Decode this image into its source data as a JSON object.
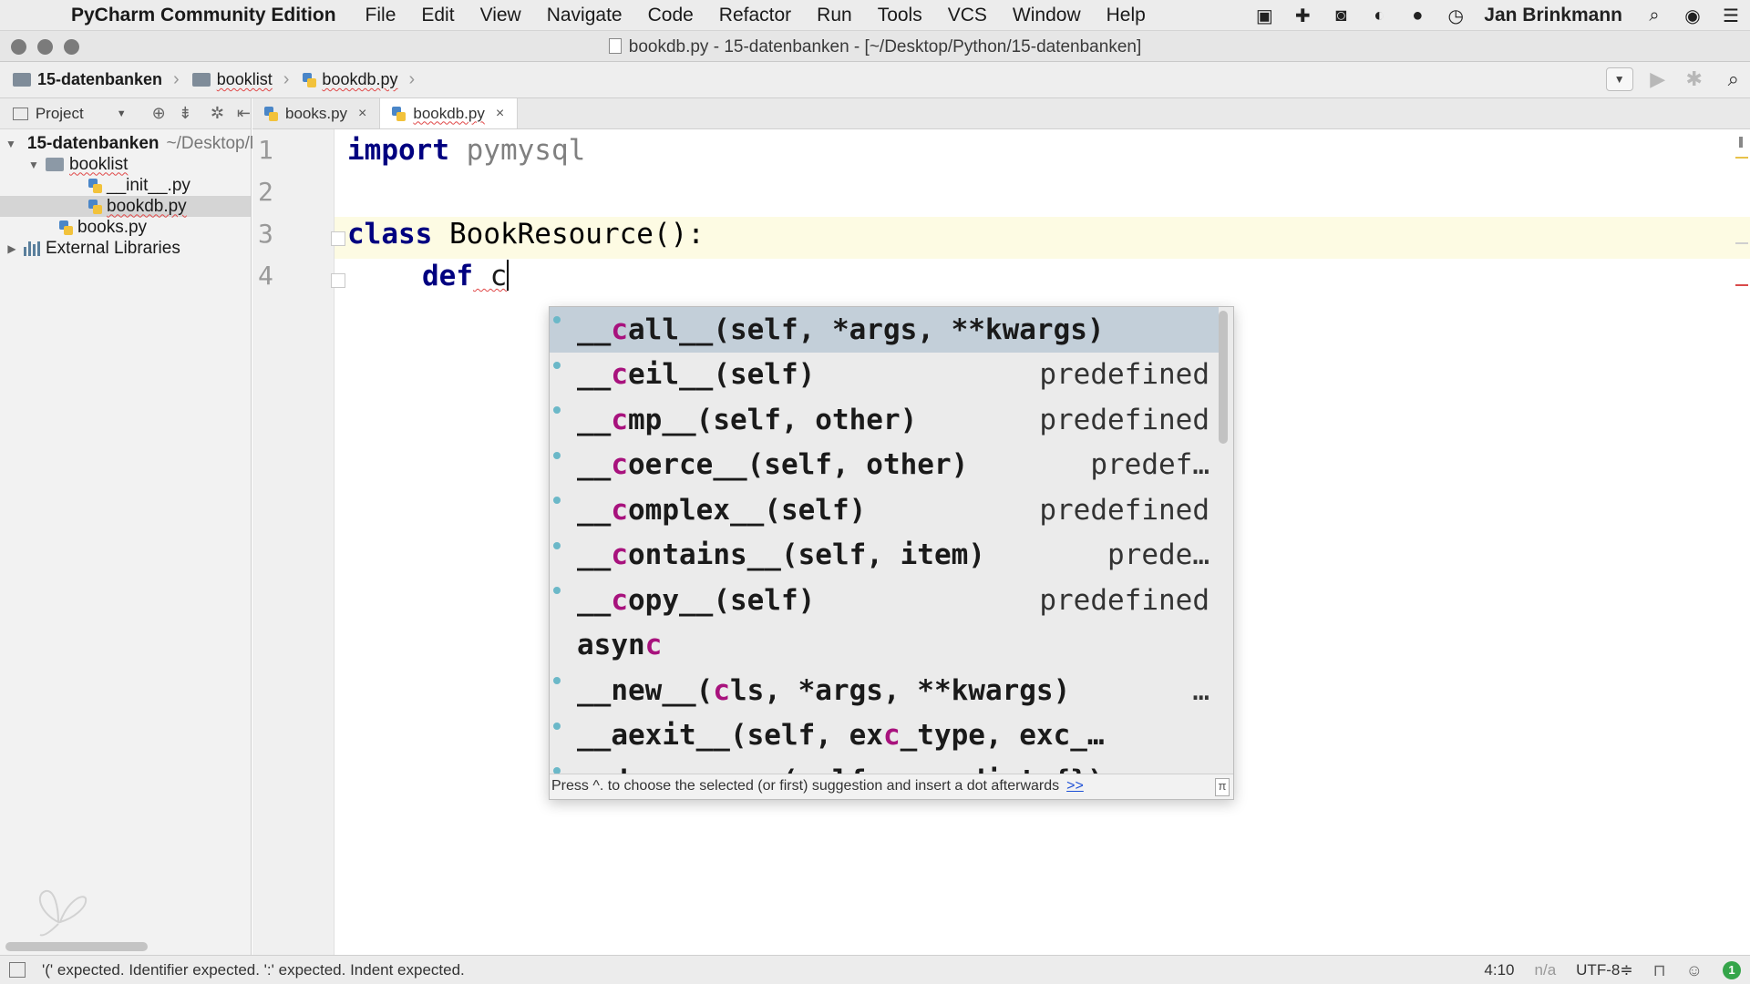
{
  "menubar": {
    "app_name": "PyCharm Community Edition",
    "items": [
      "File",
      "Edit",
      "View",
      "Navigate",
      "Code",
      "Refactor",
      "Run",
      "Tools",
      "VCS",
      "Window",
      "Help"
    ],
    "username": "Jan Brinkmann",
    "tray_icons": [
      "app-icon",
      "plus-cross-icon",
      "camera-icon",
      "leaf-icon",
      "chat-icon",
      "time-machine-icon"
    ]
  },
  "window": {
    "title": "bookdb.py - 15-datenbanken - [~/Desktop/Python/15-datenbanken]"
  },
  "breadcrumbs": [
    "15-datenbanken",
    "booklist",
    "bookdb.py"
  ],
  "project_panel": {
    "title": "Project",
    "tree": [
      {
        "label": "15-datenbanken",
        "path": "~/Desktop/l",
        "level": 0,
        "type": "folder",
        "expanded": true
      },
      {
        "label": "booklist",
        "level": 1,
        "type": "folder",
        "expanded": true
      },
      {
        "label": "__init__.py",
        "level": 2,
        "type": "python"
      },
      {
        "label": "bookdb.py",
        "level": 2,
        "type": "python",
        "selected": true
      },
      {
        "label": "books.py",
        "level": 1,
        "type": "python"
      },
      {
        "label": "External Libraries",
        "level": 0,
        "type": "library",
        "expanded": false
      }
    ]
  },
  "tabs": [
    {
      "label": "books.py",
      "active": false
    },
    {
      "label": "bookdb.py",
      "active": true
    }
  ],
  "editor": {
    "line_numbers": [
      "1",
      "2",
      "3",
      "4"
    ],
    "lines": [
      {
        "kw": "import",
        "rest": " pymysql"
      },
      {
        "kw": "",
        "rest": ""
      },
      {
        "kw": "class",
        "rest": " BookResource():"
      },
      {
        "kw": "def",
        "rest": " c"
      }
    ],
    "current_line": 4
  },
  "completion": {
    "items": [
      {
        "prefix": "__",
        "hl": "c",
        "suffix": "all__(self, *args, **kwargs)",
        "tail": "",
        "selected": true
      },
      {
        "prefix": "__",
        "hl": "c",
        "suffix": "eil__(self)",
        "tail": "predefined"
      },
      {
        "prefix": "__",
        "hl": "c",
        "suffix": "mp__(self, other)",
        "tail": "predefined"
      },
      {
        "prefix": "__",
        "hl": "c",
        "suffix": "oerce__(self, other)",
        "tail": "predef…"
      },
      {
        "prefix": "__",
        "hl": "c",
        "suffix": "omplex__(self)",
        "tail": "predefined"
      },
      {
        "prefix": "__",
        "hl": "c",
        "suffix": "ontains__(self, item)",
        "tail": "prede…"
      },
      {
        "prefix": "__",
        "hl": "c",
        "suffix": "opy__(self)",
        "tail": "predefined"
      },
      {
        "prefix": "asyn",
        "hl": "c",
        "suffix": "",
        "tail": "",
        "no_dot": true
      },
      {
        "prefix": "__new__(",
        "hl": "c",
        "suffix": "ls, *args, **kwargs)",
        "tail": "…"
      },
      {
        "prefix": "__aexit__(self, ex",
        "hl": "c",
        "suffix": "_type, exc_…",
        "tail": ""
      },
      {
        "prefix": "__deep",
        "hl": "c",
        "suffix": "opy__(self, memodict={})",
        "tail": ""
      }
    ],
    "hint": "Press ^. to choose the selected (or first) suggestion and insert a dot afterwards",
    "hint_link": ">>",
    "pi_label": "π"
  },
  "statusbar": {
    "message": "'(' expected. Identifier expected. ':' expected. Indent expected.",
    "position": "4:10",
    "na": "n/a",
    "encoding": "UTF-8≑",
    "badge": "1"
  },
  "colors": {
    "keyword": "#000080",
    "match_highlight": "#a8127d",
    "selection": "#c3cfd9",
    "current_line": "#fdfbe3"
  }
}
